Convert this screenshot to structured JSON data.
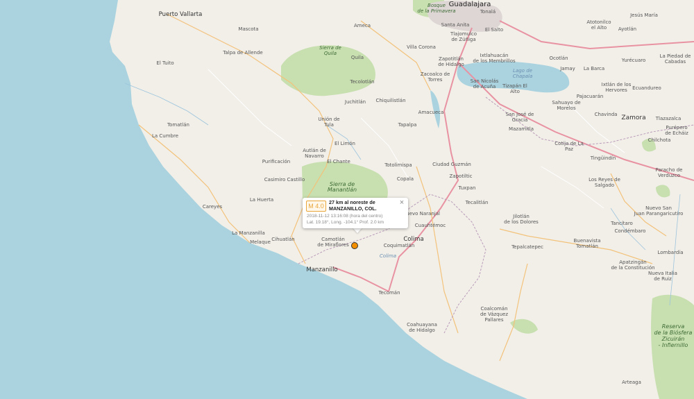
{
  "popup": {
    "magnitude": "M 4.0",
    "place_line1": "27 km al noreste de",
    "place_line2": "MANZANILLO, COL.",
    "datetime": "2018-11-12    13:16:08 (hora del centro)",
    "coords": "Lat. 19.18°, Long. -104.1°  Prof. 2.0 km",
    "close_glyph": "×"
  },
  "colors": {
    "sea": "#aad3df",
    "land": "#f2efe9",
    "park": "#c8dfb0",
    "road": "#e8a3b0",
    "highway": "#e892a2",
    "border": "#b99bb8",
    "marker": "#f28d00"
  },
  "labels": {
    "guadalajara": "Guadalajara",
    "bosque": "Bosque\nde la Primavera",
    "tonala": "Tonalá",
    "santa_anita": "Santa Anita",
    "el_salto": "El Salto",
    "tlajomulco": "Tlajomulco\nde Zúñiga",
    "puerto_vallarta": "Puerto Vallarta",
    "mascota": "Mascota",
    "ameca": "Ameca",
    "talpa": "Talpa de Allende",
    "sierra_quila": "Sierra de\nQuila",
    "quila": "Quila",
    "villa_corona": "Villa Corona",
    "el_tuito": "El Tuito",
    "tecolotlan": "Tecolotlán",
    "zapotitlan_hidalgo": "Zapotitlán\nde Hidalgo",
    "zacoalco": "Zacoalco de\nTorres",
    "ixtlahuacan": "Ixtlahuacán\nde los Membrillos",
    "lago_chapala": "Lago de\nChapala",
    "san_nicolas": "San Nicolás\nde Acuña",
    "tizapan": "Tizapán El\nAlto",
    "juchitlan": "Juchitlán",
    "chiquilistlan": "Chiquilistlán",
    "amacueca": "Amacueca",
    "union_tula": "Unión de\nTula",
    "tomatlan": "Tomatlán",
    "tapalpa": "Tapalpa",
    "la_cumbre": "La Cumbre",
    "el_limon": "El Limón",
    "autlan": "Autlán de\nNavarro",
    "el_chante": "El Chante",
    "purificacion": "Purificación",
    "totolimispa": "Totolimispa",
    "ciudad_guzman": "Ciudad Guzmán",
    "sierra_manantlan": "Sierra de\nManantlán",
    "casimiro": "Casimiro Castillo",
    "copala": "Copala",
    "zapotiltic": "Zapotiltic",
    "tuxpan": "Tuxpan",
    "la_huerta": "La Huerta",
    "careyes": "Careyes",
    "tecalitlan": "Tecalitlán",
    "nuevo_naranjal": "Nuevo Naranjal",
    "cuauhtemoc": "Cuauhtémoc",
    "la_manzanilla": "La Manzanilla",
    "cihuatlan": "Cihuatlán",
    "melaque": "Melaque",
    "camotlan": "Camotlán\nde Miraflores",
    "colima": "Colima",
    "coquimatlan": "Coquimatlán",
    "colima_state": "Colima",
    "manzanillo": "Manzanillo",
    "tecoman": "Tecomán",
    "jilotlan": "Jilotlán\nde los Dolores",
    "coahuayana": "Coahuayana\nde Hidalgo",
    "coalcoman": "Coalcomán\nde Vázquez\nPallares",
    "tepalcatepec": "Tepalcatepec",
    "buenavista": "Buenavista\nTomatlán",
    "apatzingan": "Apatzingán\nde la Constitución",
    "nueva_italia": "Nueva Italia\nde Ruiz",
    "lombardia": "Lombardía",
    "tancitaro": "Tancítaro",
    "condembaro": "Condémbaro",
    "nuevo_san_juan": "Nuevo San\nJuan Parangaricutiro",
    "los_reyes": "Los Reyes de\nSalgado",
    "tinguindin": "Tingüindín",
    "cotija": "Cotija de La\nPaz",
    "mazamitla": "Mazamitla",
    "san_jose_gracia": "San José de\nGracia",
    "chavinda": "Chavinda",
    "zamora": "Zamora",
    "tlazazalca": "Tlazazalca",
    "purepero": "Purépero\nde Echáiz",
    "chilchota": "Chilchota",
    "paracho": "Paracho de\nVerduzco",
    "sahuayo": "Sahuayo de\nMorelos",
    "jiquilpan": "Pajacuarán",
    "la_barca": "La Barca",
    "jamay": "Jamay",
    "ocotlan": "Ocotlán",
    "ixtlan_hervores": "Ixtlán de los\nHervores",
    "ecuandureo": "Ecuandureo",
    "yurecuaro": "Yurécuaro",
    "la_piedad": "La Piedad de\nCabadas",
    "atotonilco": "Atotonilco\nel Alto",
    "ayotlan": "Ayotlán",
    "jesus_maria": "Jesús María",
    "reserva": "Reserva\nde la Biósfera\nZicuirán\n- Infiernillo",
    "arteaga": "Arteaga"
  }
}
